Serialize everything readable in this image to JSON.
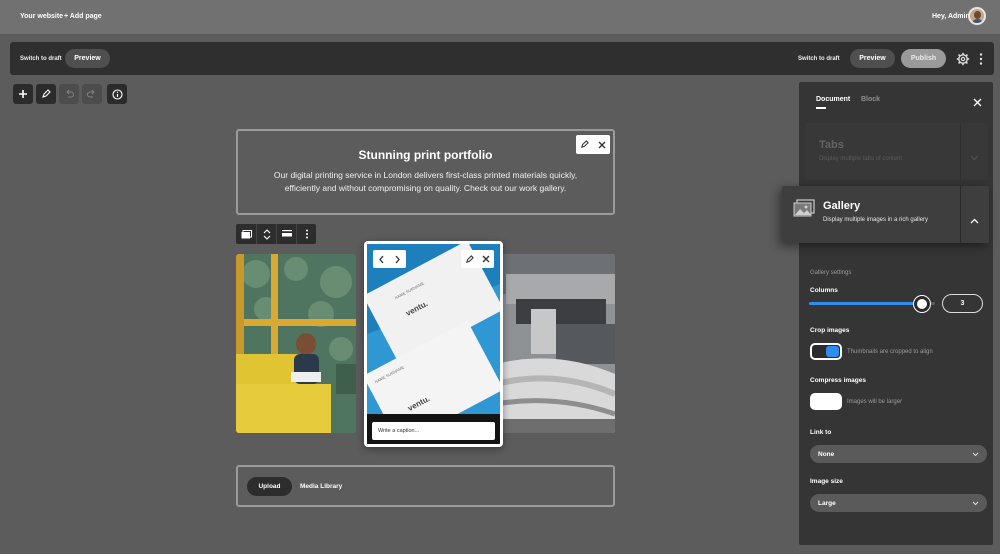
{
  "topbar": {
    "site_link": "Your website",
    "add_page": "+ Add page",
    "greeting": "Hey, Admin"
  },
  "editor_bar": {
    "switch_to_draft_left": "Switch to draft",
    "preview_left": "Preview",
    "switch_to_draft_right": "Switch to draft",
    "preview_right": "Preview",
    "publish": "Publish"
  },
  "heading_block": {
    "title": "Stunning print portfolio",
    "body": "Our digital printing service in London delivers first-class printed materials quickly, efficiently and without compromising on quality. Check out our work gallery."
  },
  "gallery": {
    "caption_placeholder": "Write a caption...",
    "card_texts": {
      "brand": "ventu.",
      "name": "NAME SURNAME"
    }
  },
  "upload_block": {
    "upload": "Upload",
    "media_library": "Media Library"
  },
  "sidebar": {
    "tabs": [
      "Document",
      "Block"
    ],
    "active_tab": "Document",
    "blocks": [
      {
        "title": "Tabs",
        "description": "Display multiple tabs of content",
        "icon": "tabs-icon"
      },
      {
        "title": "Gallery",
        "description": "Display multiple images in a rich gallery",
        "icon": "gallery-icon"
      }
    ],
    "settings_heading": "Gallery settings",
    "columns": {
      "label": "Columns",
      "value": "3",
      "slider_fraction": 0.9
    },
    "crop": {
      "label": "Crop images",
      "hint": "Thumbnails are cropped to align",
      "enabled": true
    },
    "compress": {
      "label": "Compress images",
      "hint": "Images will be larger",
      "enabled": false
    },
    "link_to": {
      "label": "Link to",
      "value": "None"
    },
    "image_size": {
      "label": "Image size",
      "value": "Large"
    }
  },
  "colors": {
    "accent": "#2f8cf0",
    "panel": "#353535",
    "canvas": "#5c5c5c"
  }
}
